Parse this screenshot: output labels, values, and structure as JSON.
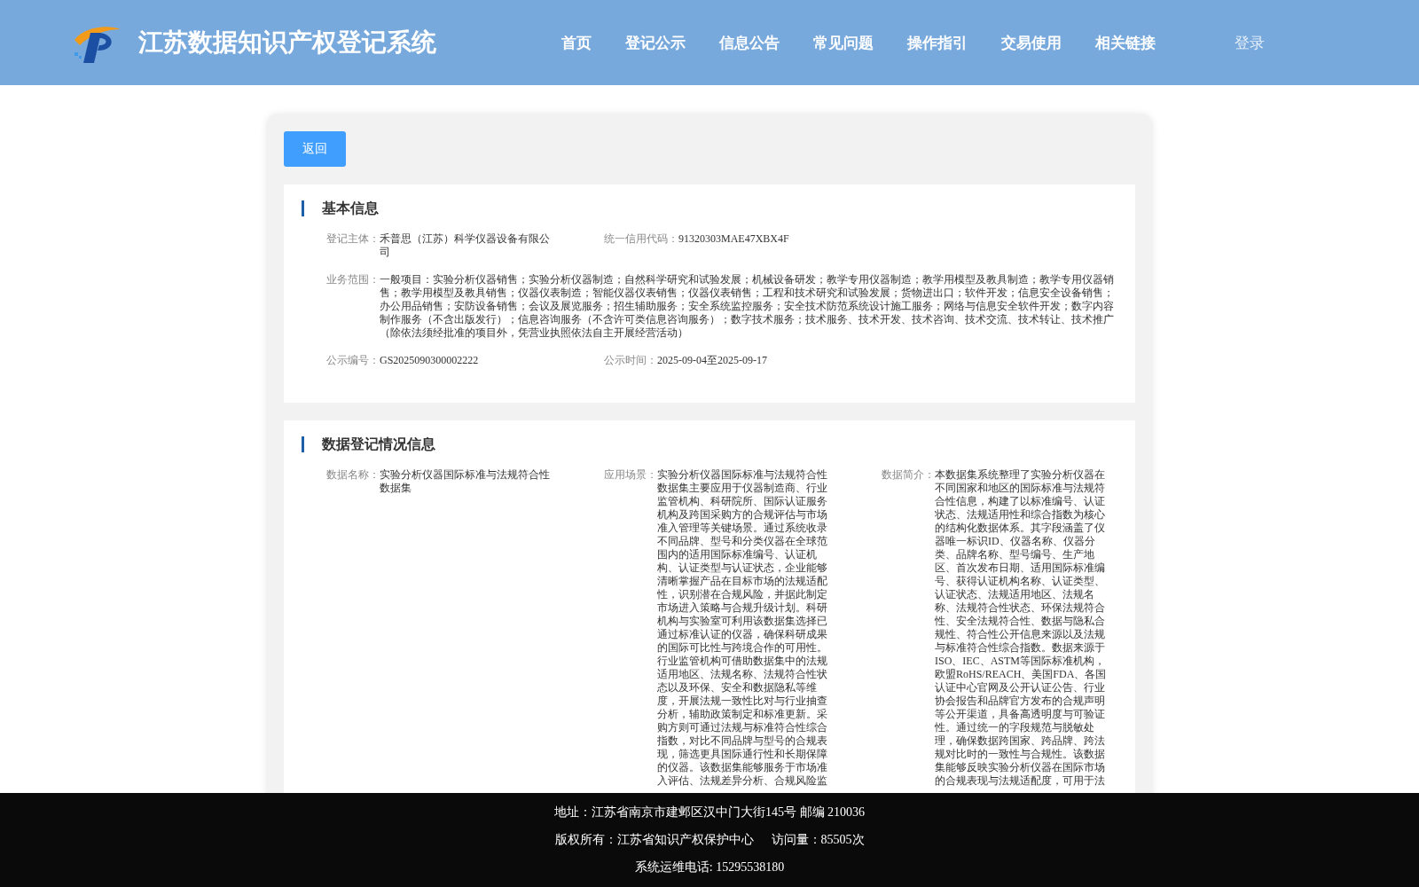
{
  "header": {
    "title": "江苏数据知识产权登记系统",
    "nav": [
      {
        "label": "首页"
      },
      {
        "label": "登记公示"
      },
      {
        "label": "信息公告"
      },
      {
        "label": "常见问题"
      },
      {
        "label": "操作指引"
      },
      {
        "label": "交易使用"
      },
      {
        "label": "相关链接"
      }
    ],
    "login": "登录"
  },
  "back_button": "返回",
  "basic_info": {
    "title": "基本信息",
    "rows": [
      {
        "fields": [
          {
            "label": "登记主体：",
            "value": "禾普思（江苏）科学仪器设备有限公司",
            "kind": "narrow"
          },
          {
            "label": "统一信用代码：",
            "value": "91320303MAE47XBX4F",
            "kind": "narrow"
          }
        ]
      },
      {
        "fields": [
          {
            "label": "业务范围：",
            "value": "一般项目：实验分析仪器销售；实验分析仪器制造；自然科学研究和试验发展；机械设备研发；教学专用仪器制造；教学用模型及教具制造；教学专用仪器销售；教学用模型及教具销售；仪器仪表制造；智能仪器仪表销售；仪器仪表销售；工程和技术研究和试验发展；货物进出口；软件开发；信息安全设备销售；办公用品销售；安防设备销售；会议及展览服务；招生辅助服务；安全系统监控服务；安全技术防范系统设计施工服务；网络与信息安全软件开发；数字内容制作服务（不含出版发行）；信息咨询服务（不含许可类信息咨询服务）；数字技术服务；技术服务、技术开发、技术咨询、技术交流、技术转让、技术推广（除依法须经批准的项目外，凭营业执照依法自主开展经营活动）",
            "kind": "wide"
          }
        ]
      },
      {
        "fields": [
          {
            "label": "公示编号：",
            "value": "GS2025090300002222",
            "kind": "narrow"
          },
          {
            "label": "公示时间：",
            "value": "2025-09-04至2025-09-17",
            "kind": "narrow"
          }
        ]
      }
    ]
  },
  "data_info": {
    "title": "数据登记情况信息",
    "fields": [
      {
        "label": "数据名称：",
        "value": "实验分析仪器国际标准与法规符合性数据集"
      },
      {
        "label": "应用场景：",
        "value": "实验分析仪器国际标准与法规符合性数据集主要应用于仪器制造商、行业监管机构、科研院所、国际认证服务机构及跨国采购方的合规评估与市场准入管理等关键场景。通过系统收录不同品牌、型号和分类仪器在全球范围内的适用国际标准编号、认证机构、认证类型与认证状态，企业能够清晰掌握产品在目标市场的法规适配性，识别潜在合规风险，并据此制定市场进入策略与合规升级计划。科研机构与实验室可利用该数据集选择已通过标准认证的仪器，确保科研成果的国际可比性与跨境合作的可用性。行业监管机构可借助数据集中的法规适用地区、法规名称、法规符合性状态以及环保、安全和数据隐私等维度，开展法规一致性比对与行业抽查分析，辅助政策制定和标准更新。采购方则可通过法规与标准符合性综合指数，对比不同品牌与型号的合规表现，筛选更具国际通行性和长期保障的仪器。该数据集能够服务于市场准入评估、法规差异分析、合规风险监"
      },
      {
        "label": "数据简介：",
        "value": "本数据集系统整理了实验分析仪器在不同国家和地区的国际标准与法规符合性信息，构建了以标准编号、认证状态、法规适用性和综合指数为核心的结构化数据体系。其字段涵盖了仪器唯一标识ID、仪器名称、仪器分类、品牌名称、型号编号、生产地区、首次发布日期、适用国际标准编号、获得认证机构名称、认证类型、认证状态、法规适用地区、法规名称、法规符合性状态、环保法规符合性、安全法规符合性、数据与隐私合规性、符合性公开信息来源以及法规与标准符合性综合指数。数据来源于ISO、IEC、ASTM等国际标准机构，欧盟RoHS/REACH、美国FDA、各国认证中心官网及公开认证公告、行业协会报告和品牌官方发布的合规声明等公开渠道，具备高透明度与可验证性。通过统一的字段规范与脱敏处理，确保数据跨国家、跨品牌、跨法规对比时的一致性与合规性。该数据集能够反映实验分析仪器在国际市场的合规表现与法规适配度，可用于法"
      }
    ]
  },
  "footer": {
    "lines": [
      {
        "parts": [
          "地址：江苏省南京市建邺区汉中门大街145号 邮编 210036"
        ]
      },
      {
        "parts": [
          "版权所有：江苏省知识产权保护中心",
          "访问量：85505次"
        ]
      },
      {
        "parts": [
          "系统运维电话: 15295538180"
        ]
      }
    ]
  }
}
